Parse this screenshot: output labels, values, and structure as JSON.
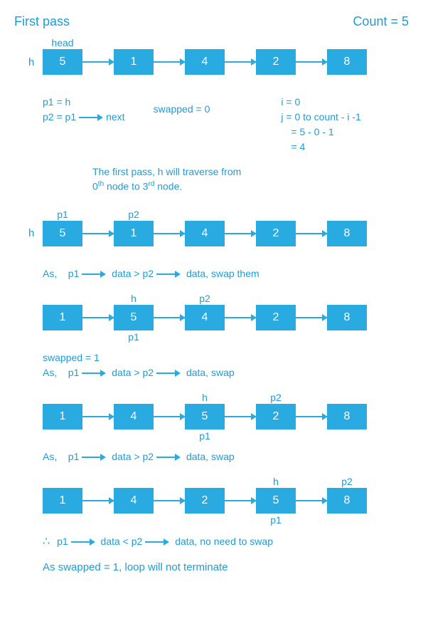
{
  "header": {
    "title": "First pass",
    "count": "Count = 5"
  },
  "labels": {
    "head": "head",
    "h": "h",
    "p1": "p1",
    "p2": "p2"
  },
  "states": [
    {
      "top": [
        "head",
        "",
        "",
        "",
        ""
      ],
      "below": [
        "",
        "",
        "",
        "",
        ""
      ],
      "nodes": [
        "5",
        "1",
        "4",
        "2",
        "8"
      ],
      "h": true
    },
    {
      "top": [
        "p1",
        "p2",
        "",
        "",
        ""
      ],
      "below": [
        "",
        "",
        "",
        "",
        ""
      ],
      "nodes": [
        "5",
        "1",
        "4",
        "2",
        "8"
      ],
      "h": true
    },
    {
      "top": [
        "",
        "h",
        "p2",
        "",
        ""
      ],
      "below": [
        "",
        "p1",
        "",
        "",
        ""
      ],
      "nodes": [
        "1",
        "5",
        "4",
        "2",
        "8"
      ],
      "h": false
    },
    {
      "top": [
        "",
        "",
        "h",
        "p2",
        ""
      ],
      "below": [
        "",
        "",
        "p1",
        "",
        ""
      ],
      "nodes": [
        "1",
        "4",
        "5",
        "2",
        "8"
      ],
      "h": false
    },
    {
      "top": [
        "",
        "",
        "",
        "h",
        "p2"
      ],
      "below": [
        "",
        "",
        "",
        "p1",
        ""
      ],
      "nodes": [
        "1",
        "4",
        "2",
        "5",
        "8"
      ],
      "h": false
    }
  ],
  "annot": {
    "init_p1": "p1 = h",
    "init_p2_pre": "p2 = p1",
    "init_p2_post": "next",
    "swapped0": "swapped = 0",
    "i": "i = 0",
    "j1": "j = 0  to  count  - i -1",
    "j2": "= 5 - 0 - 1",
    "j3": "= 4",
    "pass_desc1": "The first pass, h will traverse from",
    "pass_desc2_a": "0",
    "pass_desc2_b": " node to 3",
    "pass_desc2_c": " node.",
    "sup_th": "th",
    "sup_rd": "rd",
    "as": "As,",
    "p1txt": "p1",
    "p2txt": "p2",
    "data_gt": "data > p2",
    "data_lt": "data < p2",
    "swap_them": "data,  swap them",
    "swap": "data,  swap",
    "no_swap": "data,  no need to swap",
    "swapped1": "swapped  =  1",
    "therefore": "∴",
    "final": "As swapped  =  1,  loop will not terminate"
  }
}
